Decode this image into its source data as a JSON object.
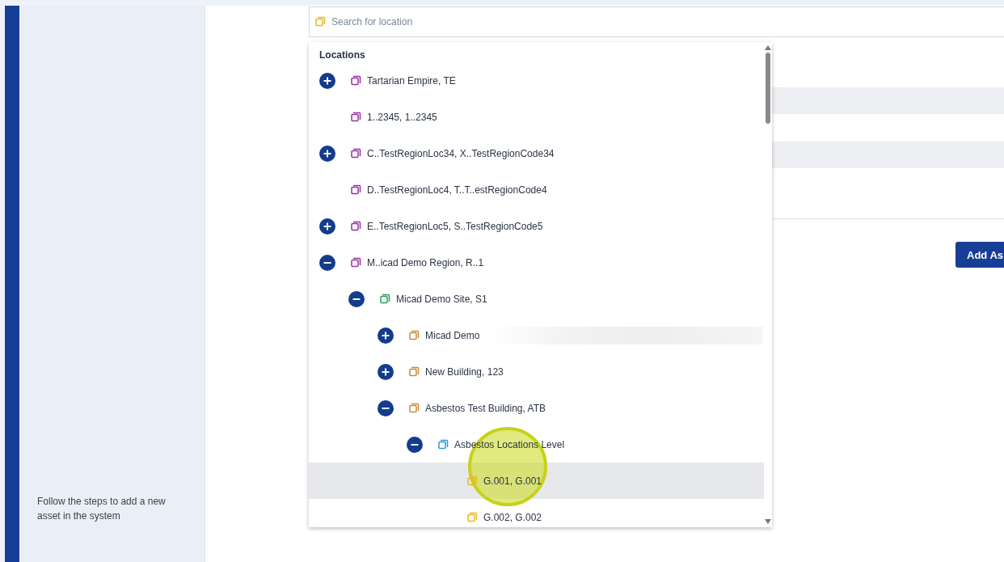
{
  "search": {
    "placeholder": "Search for location"
  },
  "locations": {
    "title": "Locations",
    "tree": [
      {
        "label": "Tartarian Empire, TE",
        "color": "#9b2fa8",
        "kind": "branch",
        "expanded": false,
        "selected": false
      },
      {
        "label": "1..2345, 1..2345",
        "color": "#9b2fa8",
        "kind": "leaf",
        "selected": false
      },
      {
        "label": "C..TestRegionLoc34, X..TestRegionCode34",
        "color": "#9b2fa8",
        "kind": "branch",
        "expanded": false,
        "selected": false
      },
      {
        "label": "D..TestRegionLoc4, T..T..estRegionCode4",
        "color": "#9b2fa8",
        "kind": "leaf",
        "selected": false
      },
      {
        "label": "E..TestRegionLoc5, S..TestRegionCode5",
        "color": "#9b2fa8",
        "kind": "branch",
        "expanded": false,
        "selected": false
      },
      {
        "label": "M..icad Demo Region, R..1",
        "color": "#9b2fa8",
        "kind": "branch",
        "expanded": true,
        "selected": false,
        "children": [
          {
            "label": "Micad Demo Site, S1",
            "color": "#2e9e5b",
            "kind": "branch",
            "expanded": true,
            "selected": false,
            "children": [
              {
                "label": "Micad Demo",
                "color": "#c98a3a",
                "kind": "branch",
                "expanded": false,
                "selected": false
              },
              {
                "label": "New Building, 123",
                "color": "#c98a3a",
                "kind": "branch",
                "expanded": false,
                "selected": false
              },
              {
                "label": "Asbestos Test Building, ATB",
                "color": "#c98a3a",
                "kind": "branch",
                "expanded": true,
                "selected": false,
                "children": [
                  {
                    "label": "Asbestos Locations Level",
                    "color": "#2d9ad6",
                    "kind": "branch",
                    "expanded": true,
                    "selected": false,
                    "children": [
                      {
                        "label": "G.001, G.001",
                        "color": "#e5b820",
                        "kind": "leaf",
                        "selected": true
                      },
                      {
                        "label": "G.002, G.002",
                        "color": "#e5b820",
                        "kind": "leaf",
                        "selected": false
                      }
                    ]
                  }
                ]
              }
            ]
          }
        ]
      }
    ]
  },
  "sidebar": {
    "hint": "Follow the steps to add a new asset in the system"
  },
  "actions": {
    "add_button": "Add As"
  }
}
